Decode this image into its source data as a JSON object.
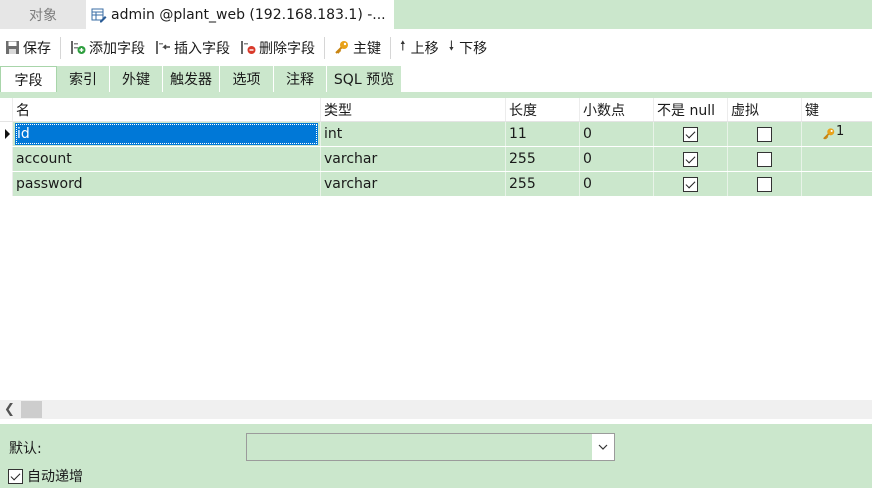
{
  "window_tabs": [
    {
      "label": "对象",
      "active": false
    },
    {
      "label": "admin @plant_web (192.168.183.1) -...",
      "active": true
    }
  ],
  "toolbar": {
    "save": "保存",
    "add_field": "添加字段",
    "insert_field": "插入字段",
    "delete_field": "删除字段",
    "primary_key": "主键",
    "move_up": "上移",
    "move_down": "下移"
  },
  "subtabs": [
    "字段",
    "索引",
    "外键",
    "触发器",
    "选项",
    "注释",
    "SQL 预览"
  ],
  "grid": {
    "headers": [
      "名",
      "类型",
      "长度",
      "小数点",
      "不是 null",
      "虚拟",
      "键"
    ],
    "rows": [
      {
        "name": "id",
        "type": "int",
        "length": "11",
        "decimals": "0",
        "not_null": true,
        "virtual": false,
        "key": "1",
        "selected": true
      },
      {
        "name": "account",
        "type": "varchar",
        "length": "255",
        "decimals": "0",
        "not_null": true,
        "virtual": false,
        "key": ""
      },
      {
        "name": "password",
        "type": "varchar",
        "length": "255",
        "decimals": "0",
        "not_null": true,
        "virtual": false,
        "key": ""
      }
    ]
  },
  "bottom": {
    "default_label": "默认:",
    "default_value": "",
    "auto_increment_label": "自动递增",
    "auto_increment_checked": true
  },
  "colors": {
    "accent_green": "#cbe7cc",
    "selection_blue": "#0078d7"
  }
}
